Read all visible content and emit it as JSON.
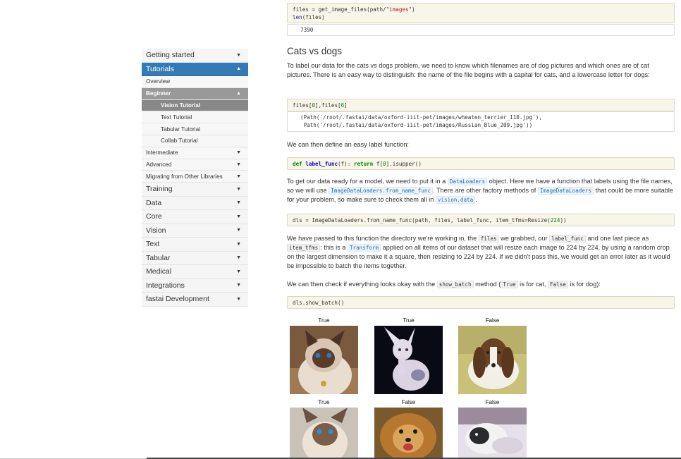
{
  "sidebar": {
    "items": [
      {
        "label": "Getting started",
        "arrow": "▼",
        "level": "top"
      },
      {
        "label": "Tutorials",
        "arrow": "▲",
        "level": "top",
        "active": true
      },
      {
        "label": "Overview",
        "arrow": "",
        "level": "sub"
      },
      {
        "label": "Beginner",
        "arrow": "▲",
        "level": "sub",
        "active": true
      },
      {
        "label": "Vision Tutorial",
        "arrow": "",
        "level": "leaf",
        "active": true
      },
      {
        "label": "Text Tutorial",
        "arrow": "",
        "level": "leaf"
      },
      {
        "label": "Tabular Tutorial",
        "arrow": "",
        "level": "leaf"
      },
      {
        "label": "Collab Tutorial",
        "arrow": "",
        "level": "leaf"
      },
      {
        "label": "Intermediate",
        "arrow": "▼",
        "level": "sub"
      },
      {
        "label": "Advanced",
        "arrow": "▼",
        "level": "sub"
      },
      {
        "label": "Migrating from Other Libraries",
        "arrow": "▼",
        "level": "sub"
      },
      {
        "label": "Training",
        "arrow": "▼",
        "level": "top"
      },
      {
        "label": "Data",
        "arrow": "▼",
        "level": "top"
      },
      {
        "label": "Core",
        "arrow": "▼",
        "level": "top"
      },
      {
        "label": "Vision",
        "arrow": "▼",
        "level": "top"
      },
      {
        "label": "Text",
        "arrow": "▼",
        "level": "top"
      },
      {
        "label": "Tabular",
        "arrow": "▼",
        "level": "top"
      },
      {
        "label": "Medical",
        "arrow": "▼",
        "level": "top"
      },
      {
        "label": "Integrations",
        "arrow": "▼",
        "level": "top"
      },
      {
        "label": "fastai Development",
        "arrow": "▼",
        "level": "top"
      }
    ]
  },
  "content": {
    "code1": {
      "line1_a": "files = get_image_files(path/",
      "line1_str": "\"images\"",
      "line1_b": ")",
      "line2_fn": "len",
      "line2_b": "(files)"
    },
    "output1": "7390",
    "heading": "Cats vs dogs",
    "para1": "To label our data for the cats vs dogs problem, we need to know which filenames are of dog pictures and which ones are of cat pictures. There is an easy way to distinguish: the name of the file begins with a capital for cats, and a lowercase letter for dogs:",
    "code2": {
      "a": "files[",
      "n0": "0",
      "b": "],files[",
      "n6": "6",
      "c": "]"
    },
    "output2_line1": "(Path('/root/.fastai/data/oxford-iiit-pet/images/wheaten_terrier_110.jpg'),",
    "output2_line2": " Path('/root/.fastai/data/oxford-iiit-pet/images/Russian_Blue_209.jpg'))",
    "para2": "We can then define an easy label function:",
    "code3": {
      "def": "def",
      "name": "label_func",
      "a": "(f): ",
      "ret": "return",
      "b": " f[",
      "n0": "0",
      "c": "].isupper()"
    },
    "para3": {
      "t1": "To get our data ready for a model, we need to put it in a ",
      "c1": "DataLoaders",
      "t2": " object. Here we have a function that labels using the file names, so we will use ",
      "c2": "ImageDataLoaders.from_name_func",
      "t3": ". There are other factory methods of ",
      "c3": "ImageDataLoaders",
      "t4": " that could be more suitable for your problem, so make sure to check them all in ",
      "c4": "vision.data",
      "t5": "."
    },
    "code4": {
      "a": "dls = ImageDataLoaders.from_name_func(path, files, label_func, item_tfms=Resize(",
      "n": "224",
      "b": "))"
    },
    "para4": {
      "t1": "We have passed to this function the directory we're working in, the ",
      "c1": "files",
      "t2": " we grabbed, our ",
      "c2": "label_func",
      "t3": " and one last piece as ",
      "c3": "item_tfms",
      "t4": ": this is a ",
      "c4": "Transform",
      "t5": " applied on all items of our dataset that will resize each image to 224 by 224, by using a random crop on the largest dimension to make it a square, then resizing to 224 by 224. If we didn't pass this, we would get an error later as it would be impossible to batch the items together."
    },
    "para5": {
      "t1": "We can then check if everything looks okay with the ",
      "c1": "show_batch",
      "t2": " method (",
      "c2": "True",
      "t3": " is for cat, ",
      "c3": "False",
      "t4": " is for dog):"
    },
    "code5": "dls.show_batch()",
    "batch": [
      {
        "label": "True"
      },
      {
        "label": "True"
      },
      {
        "label": "False"
      },
      {
        "label": "True"
      },
      {
        "label": "False"
      },
      {
        "label": "False"
      }
    ]
  },
  "colors": {
    "accent": "#337ab7",
    "code_bg": "#f8f6e8"
  }
}
